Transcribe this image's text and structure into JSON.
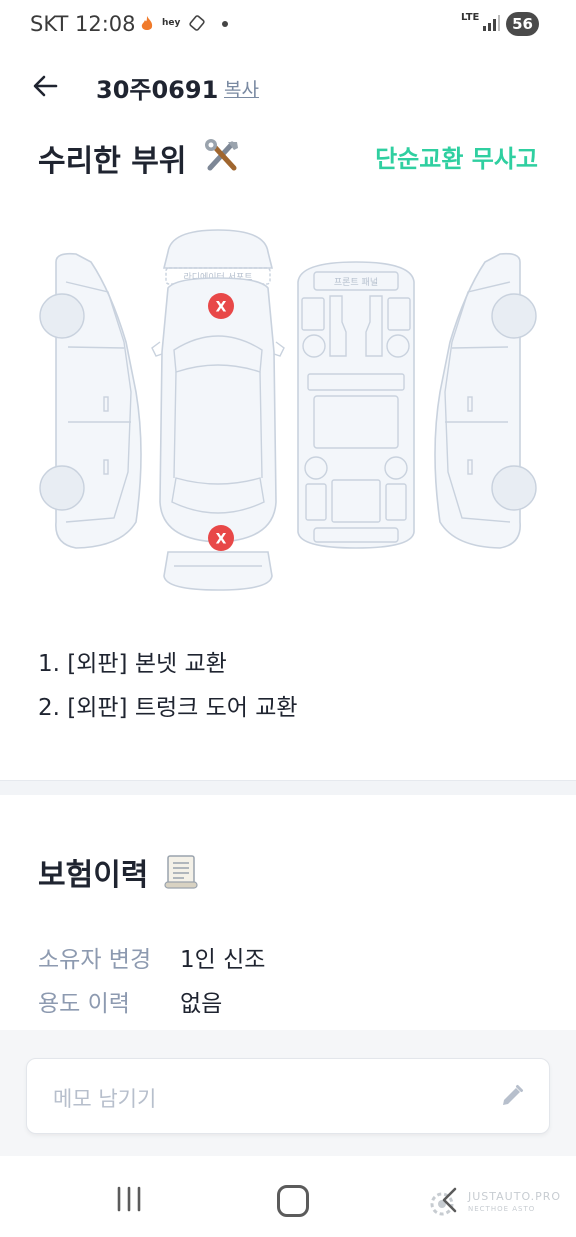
{
  "status_bar": {
    "time": "SKT 12:08",
    "hey_label": "hey",
    "network": "LTE",
    "battery": "56"
  },
  "header": {
    "plate_number": "30주0691",
    "copy_label": "복사"
  },
  "repair_section": {
    "title": "수리한 부위",
    "title_icon": "tools-icon",
    "status": "단순교환 무사고",
    "status_color": "#2fcfa0",
    "diagram_labels": {
      "radiator_support": "라디에이터 서포트",
      "front_panel": "프론트 패널"
    },
    "marker_symbol": "X",
    "marker_color": "#e84848",
    "items": [
      "1. [외판] 본넷 교환",
      "2. [외판] 트렁크 도어 교환"
    ]
  },
  "insurance_section": {
    "title": "보험이력",
    "title_icon": "scroll-icon",
    "rows": [
      {
        "label": "소유자 변경",
        "value": "1인 신조"
      },
      {
        "label": "용도 이력",
        "value": "없음"
      }
    ]
  },
  "memo": {
    "placeholder": "메모 남기기",
    "icon": "pencil-icon"
  },
  "watermark": {
    "line1": "JUSTAUTO.PRO",
    "line2": "NECTHOE ASTO"
  }
}
